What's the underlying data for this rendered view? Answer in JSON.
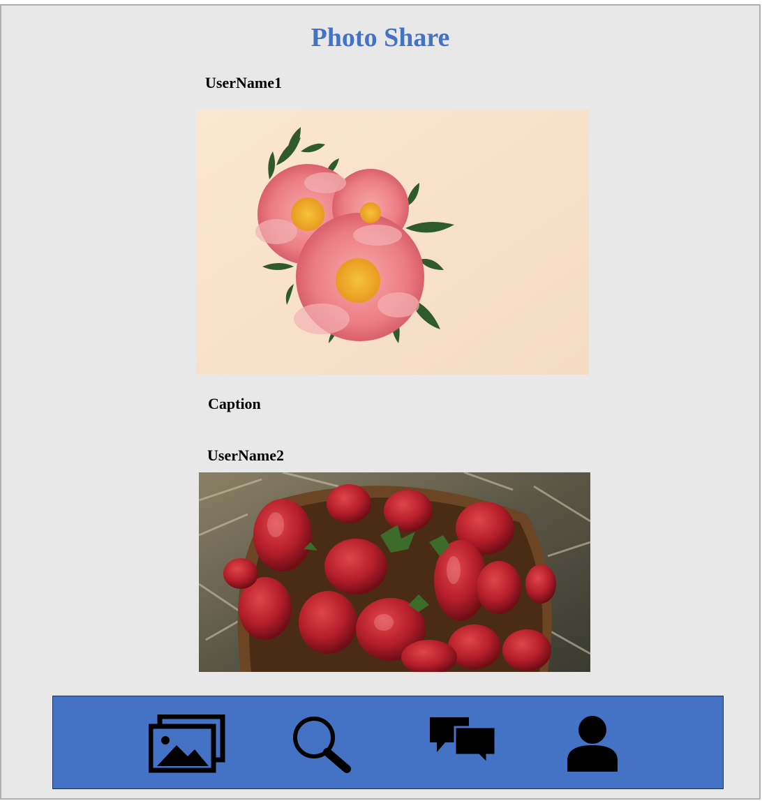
{
  "app": {
    "title": "Photo Share"
  },
  "feed": {
    "posts": [
      {
        "username": "UserName1",
        "photo": "pink-peony-flowers-photo",
        "caption": "Caption"
      },
      {
        "username": "UserName2",
        "photo": "strawberries-basket-photo"
      }
    ]
  },
  "nav": {
    "items": [
      {
        "icon": "gallery-icon"
      },
      {
        "icon": "search-icon"
      },
      {
        "icon": "chat-icon"
      },
      {
        "icon": "profile-icon"
      }
    ]
  },
  "colors": {
    "accent": "#4472c4",
    "background": "#e8e8e8",
    "nav_bar": "#4472c4",
    "icon": "#000000"
  }
}
